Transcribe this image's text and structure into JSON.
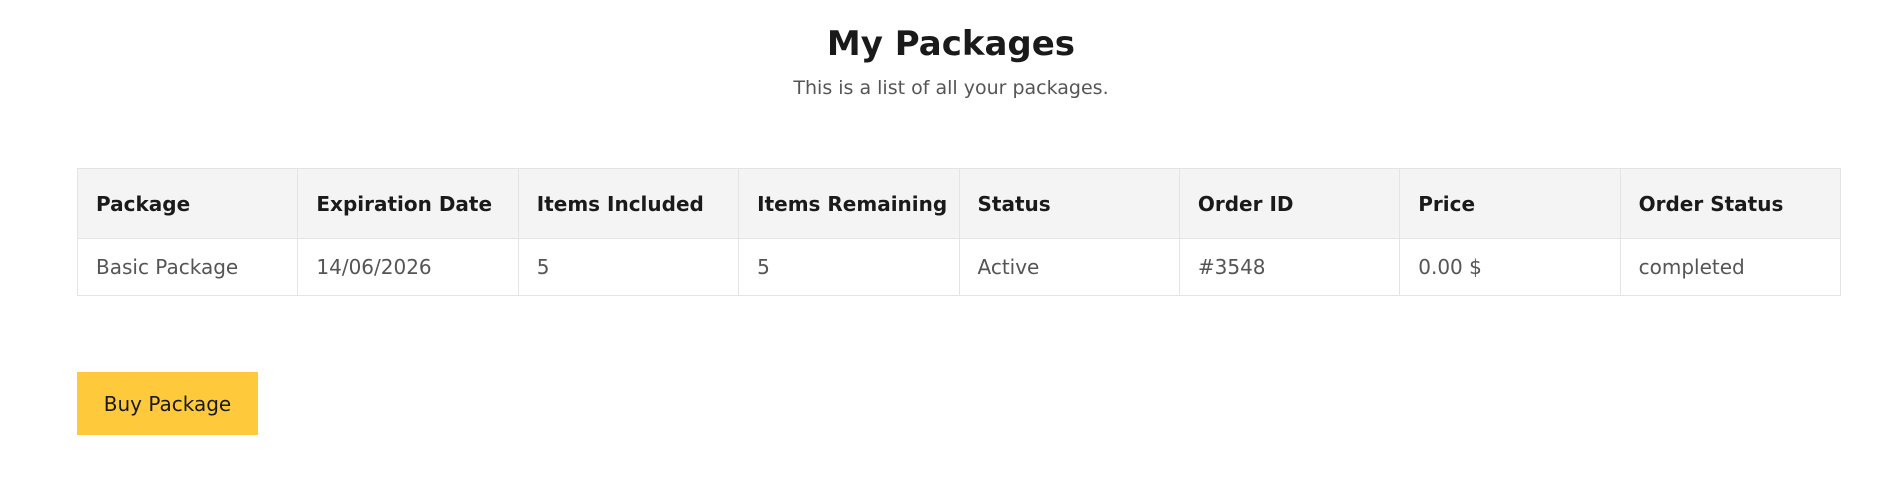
{
  "header": {
    "title": "My Packages",
    "subtitle": "This is a list of all your packages."
  },
  "table": {
    "columns": [
      "Package",
      "Expiration Date",
      "Items Included",
      "Items Remaining",
      "Status",
      "Order ID",
      "Price",
      "Order Status"
    ],
    "rows": [
      [
        "Basic Package",
        "14/06/2026",
        "5",
        "5",
        "Active",
        "#3548",
        "0.00 $",
        "completed"
      ]
    ]
  },
  "actions": {
    "buy_label": "Buy Package"
  },
  "colors": {
    "button_background": "#ffc93c",
    "header_row_background": "#f4f4f4",
    "border": "#e4e4e4"
  }
}
